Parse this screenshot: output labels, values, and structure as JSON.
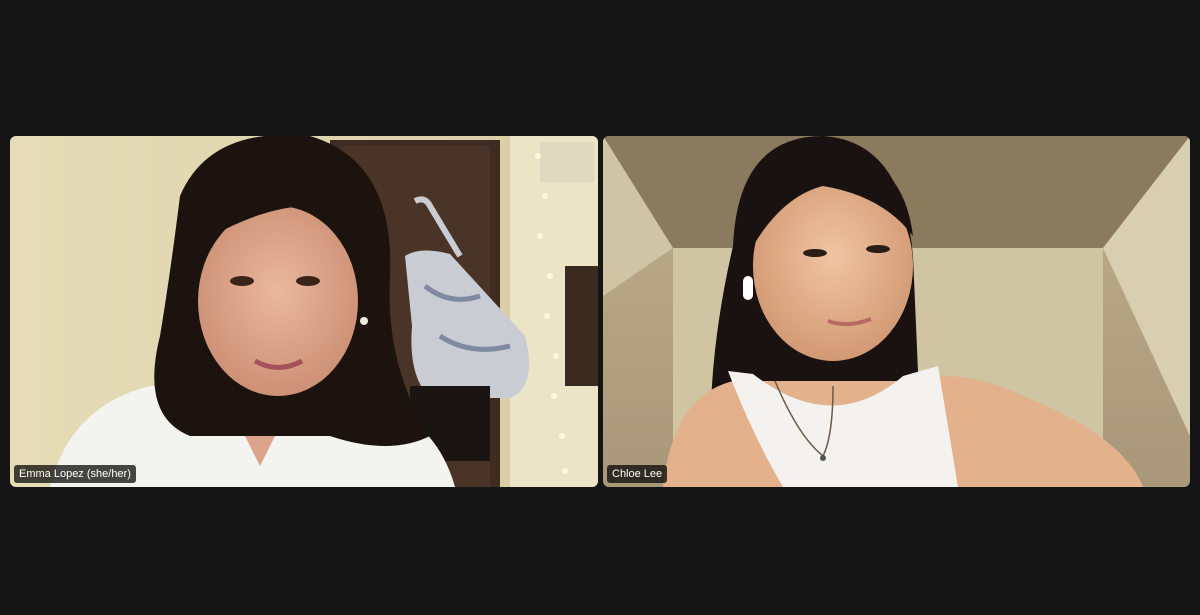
{
  "meeting": {
    "participants": [
      {
        "name": "Emma Lopez (she/her)",
        "background_color": "#e9dfbd"
      },
      {
        "name": "Chloe Lee",
        "background_color": "#c8b896"
      }
    ]
  },
  "theme": {
    "window_background": "#151515",
    "label_background": "#000000",
    "label_text": "#ffffff"
  }
}
